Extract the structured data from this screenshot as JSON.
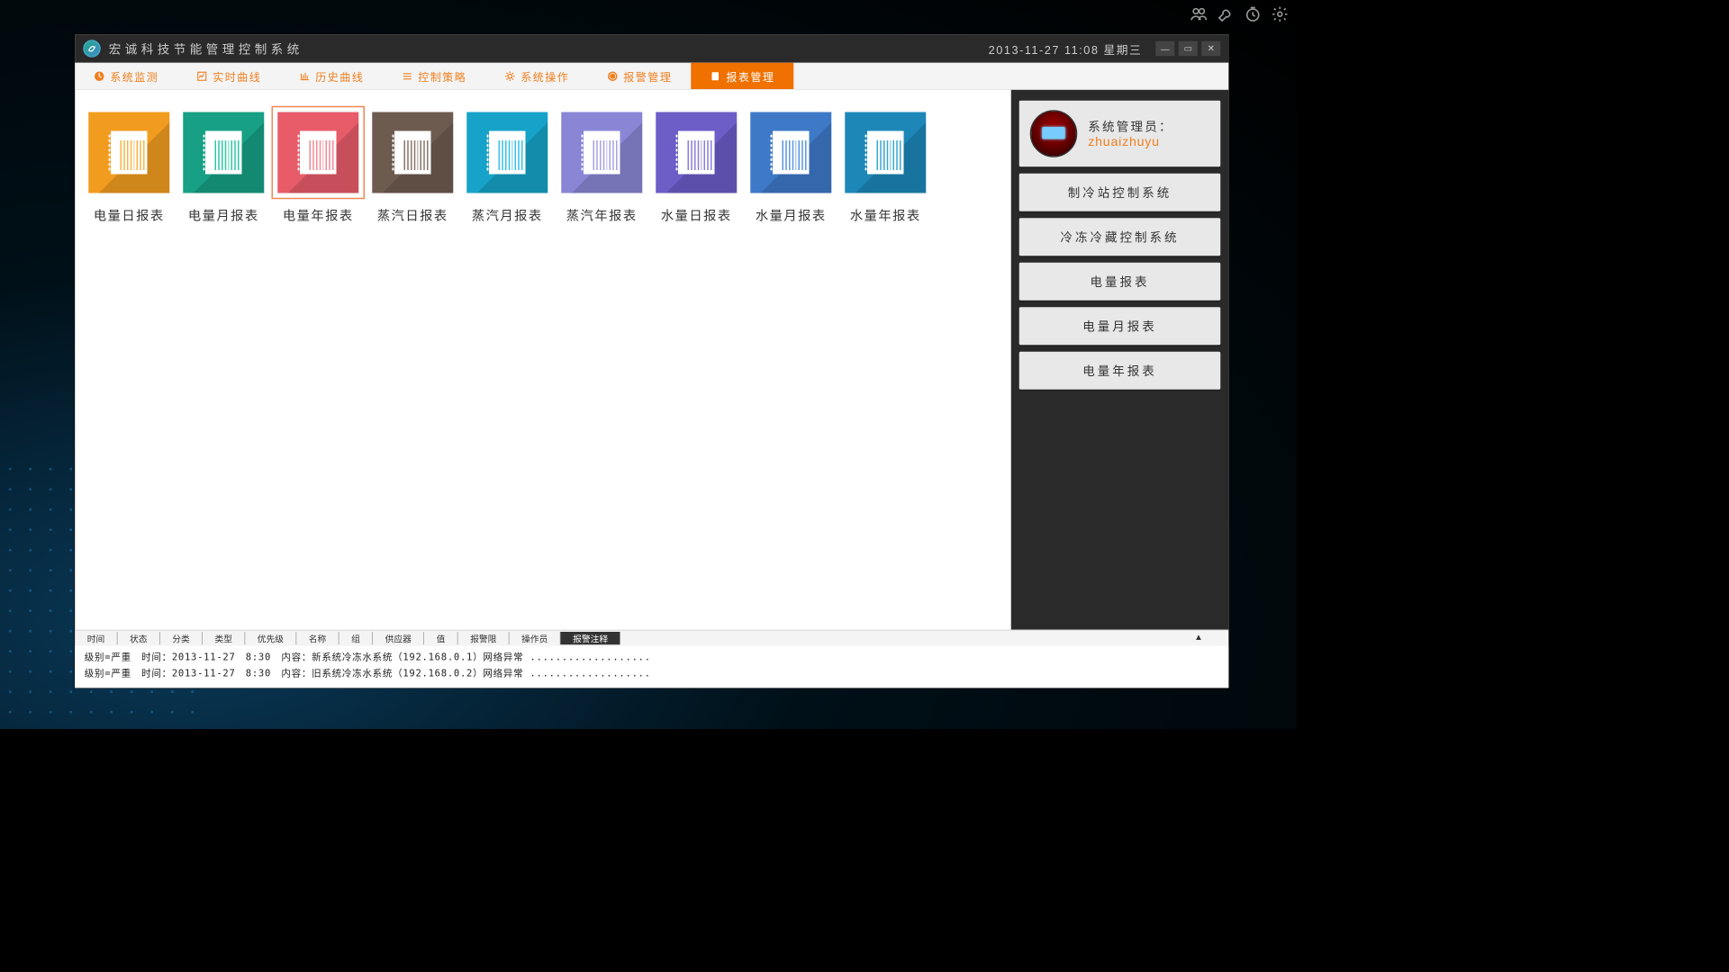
{
  "app": {
    "title": "宏诚科技节能管理控制系统",
    "datetime": "2013-11-27 11:08 星期三"
  },
  "nav": {
    "items": [
      {
        "label": "系统监测"
      },
      {
        "label": "实时曲线"
      },
      {
        "label": "历史曲线"
      },
      {
        "label": "控制策略"
      },
      {
        "label": "系统操作"
      },
      {
        "label": "报警管理"
      },
      {
        "label": "报表管理"
      }
    ],
    "activeIndex": 6
  },
  "tiles": [
    {
      "label": "电量日报表",
      "color": "#f29c1f",
      "line": "#f7b54a"
    },
    {
      "label": "电量月报表",
      "color": "#17a085",
      "line": "#2dc7a6"
    },
    {
      "label": "电量年报表",
      "color": "#e85c6a",
      "line": "#f28a95",
      "selected": true
    },
    {
      "label": "蒸汽日报表",
      "color": "#6e5b50",
      "line": "#8a766a"
    },
    {
      "label": "蒸汽月报表",
      "color": "#17a3c9",
      "line": "#36c0e3"
    },
    {
      "label": "蒸汽年报表",
      "color": "#8a86d6",
      "line": "#a7a3e6"
    },
    {
      "label": "水量日报表",
      "color": "#6c5dc7",
      "line": "#8b7ddc"
    },
    {
      "label": "水量月报表",
      "color": "#3d79c7",
      "line": "#5a97e0"
    },
    {
      "label": "水量年报表",
      "color": "#1d88b8",
      "line": "#3aa7d4"
    }
  ],
  "sidebar": {
    "roleLabel": "系统管理员：",
    "username": "zhuaizhuyu",
    "buttons": [
      "制冷站控制系统",
      "冷冻冷藏控制系统",
      "电量报表",
      "电量月报表",
      "电量年报表"
    ]
  },
  "table": {
    "headers": [
      "时间",
      "状态",
      "分类",
      "类型",
      "优先级",
      "名称",
      "组",
      "供应器",
      "值",
      "报警限",
      "操作员",
      "报警注释"
    ],
    "activeHeaderIndex": 11
  },
  "logs": [
    "级别=严重　时间：2013-11-27　8:30　内容：新系统冷冻水系统（192.168.0.1）网络异常 ...................",
    "级别=严重　时间：2013-11-27　8:30　内容：旧系统冷冻水系统（192.168.0.2）网络异常 ..................."
  ]
}
